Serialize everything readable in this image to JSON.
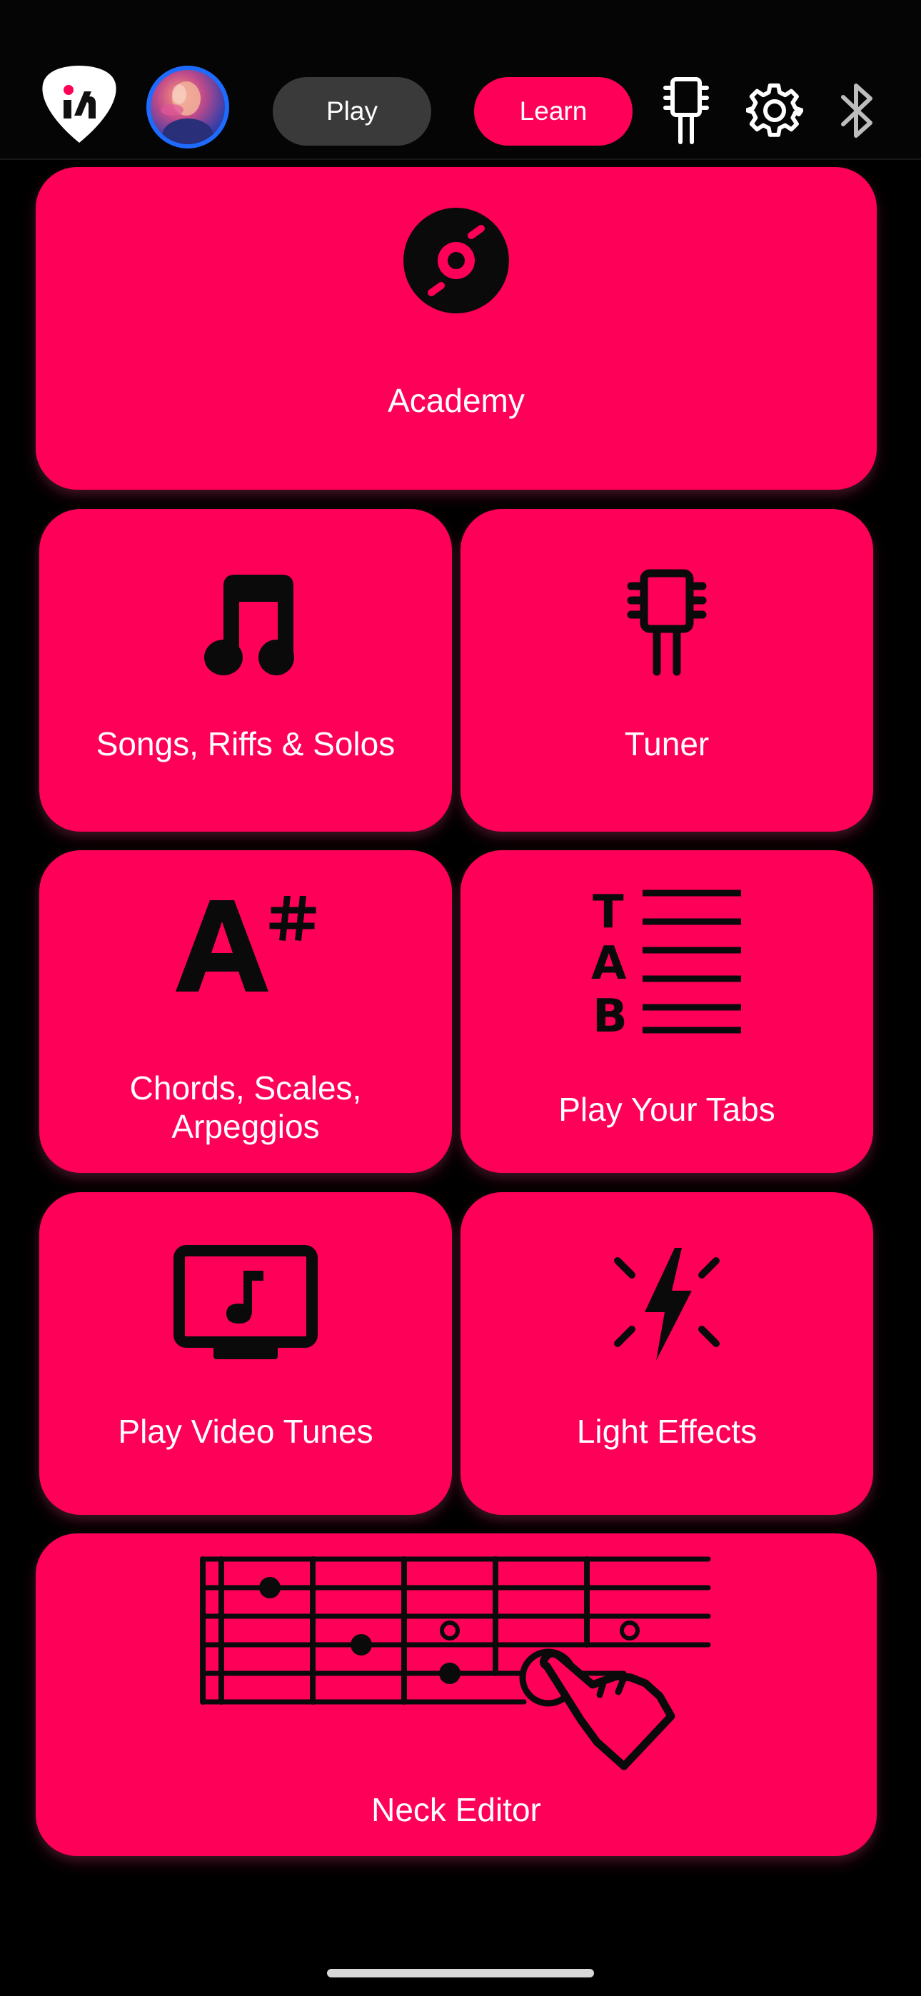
{
  "header": {
    "logo_icon": "picked-logo-icon",
    "avatar_icon": "user-avatar",
    "play_label": "Play",
    "learn_label": "Learn",
    "tuner_icon": "tuner-icon",
    "settings_icon": "gear-icon",
    "bluetooth_icon": "bluetooth-icon",
    "accent_color": "#ff0059",
    "play_pill_color": "#3a3a3a",
    "active_tab": "Learn"
  },
  "cards": {
    "academy": {
      "label": "Academy",
      "icon": "vinyl-record-icon"
    },
    "songs": {
      "label": "Songs, Riffs & Solos",
      "icon": "music-note-icon"
    },
    "tuner": {
      "label": "Tuner",
      "icon": "tuner-icon"
    },
    "chords": {
      "label_line1": "Chords, Scales,",
      "label_line2": "Arpeggios",
      "icon": "a-sharp-icon"
    },
    "tabs": {
      "label": "Play Your Tabs",
      "icon": "tab-staff-icon"
    },
    "video": {
      "label": "Play Video Tunes",
      "icon": "video-music-icon"
    },
    "light": {
      "label": "Light Effects",
      "icon": "lightning-flash-icon"
    },
    "neck": {
      "label": "Neck Editor",
      "icon": "fretboard-tap-icon"
    }
  },
  "theme": {
    "card_color": "#ff0059",
    "background": "#000000",
    "text_color": "#ffffff",
    "icon_color": "#0a0a0a"
  }
}
